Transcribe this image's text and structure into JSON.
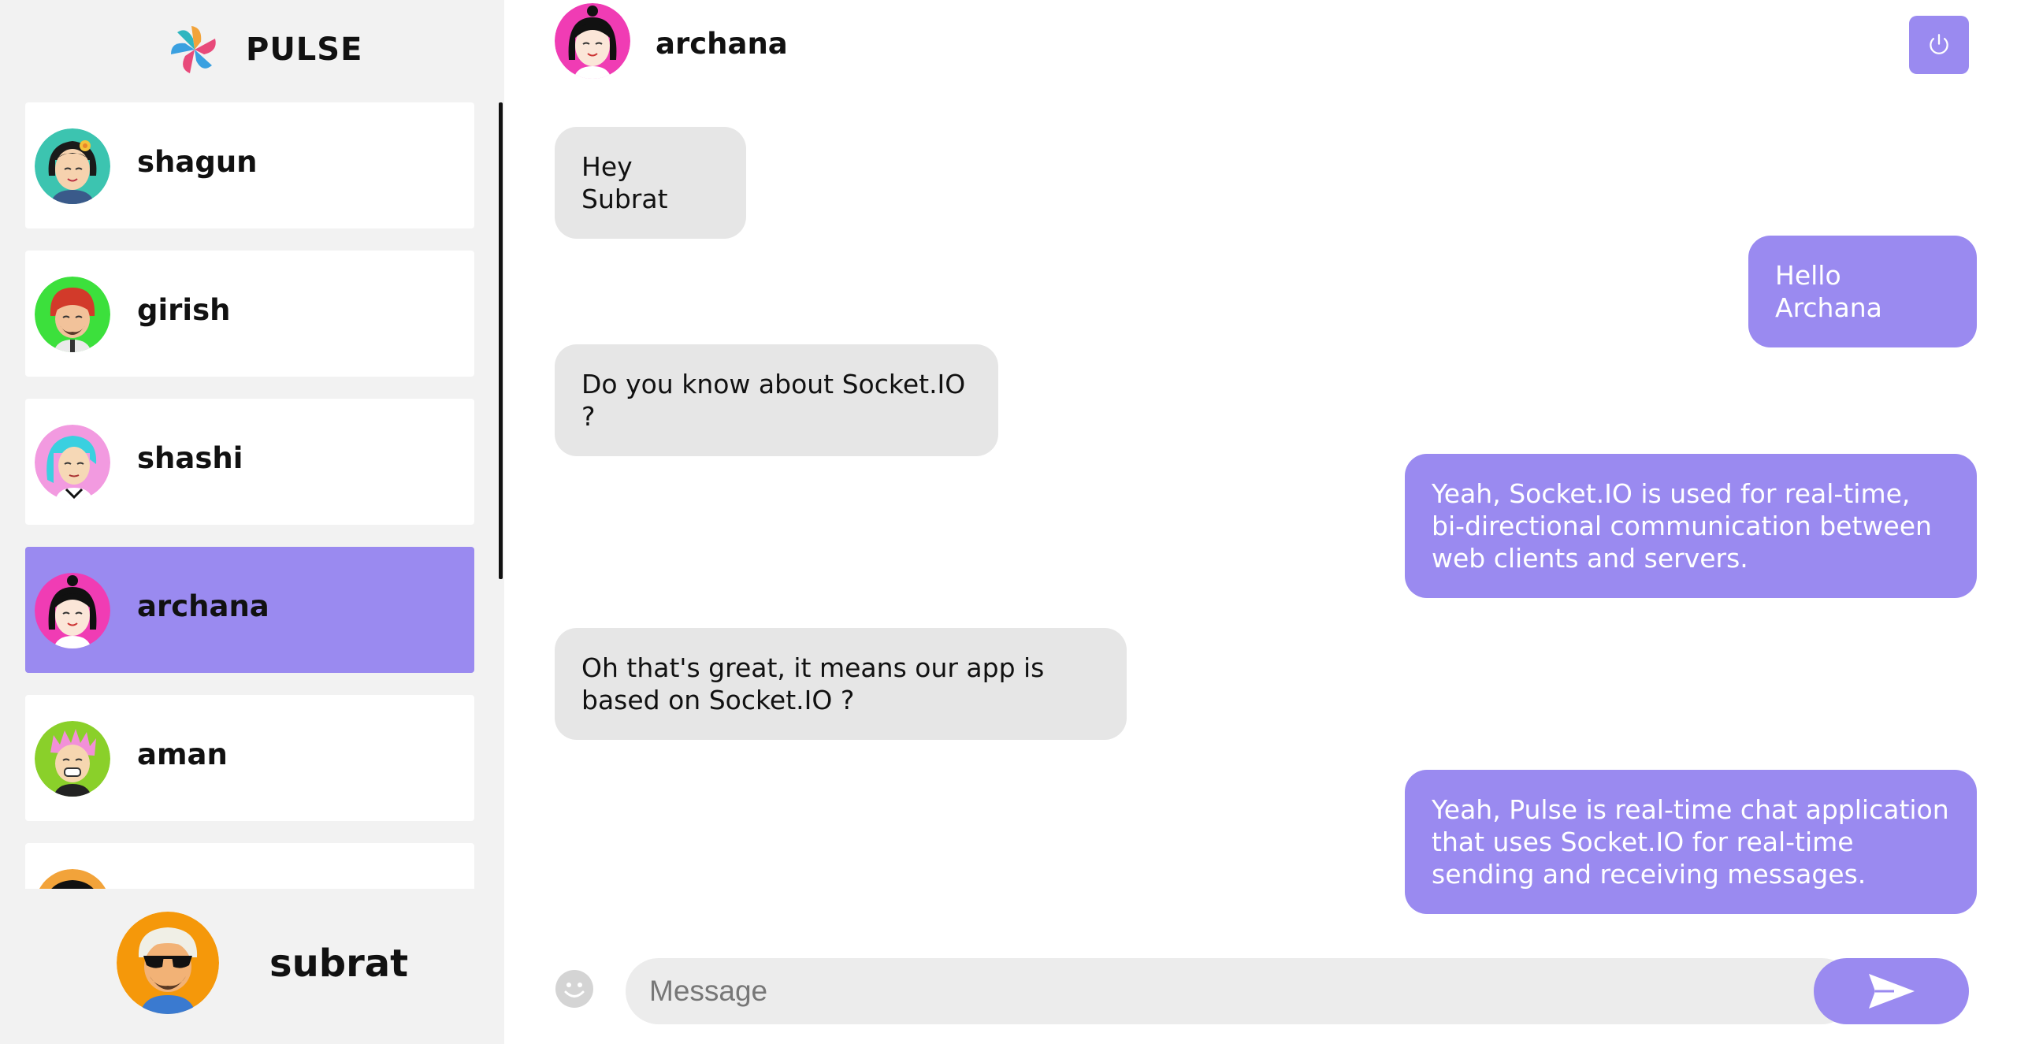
{
  "brand": {
    "name": "PULSE"
  },
  "contacts": [
    {
      "name": "shagun",
      "active": false
    },
    {
      "name": "girish",
      "active": false
    },
    {
      "name": "shashi",
      "active": false
    },
    {
      "name": "archana",
      "active": true
    },
    {
      "name": "aman",
      "active": false
    }
  ],
  "current_user": {
    "name": "subrat"
  },
  "chat": {
    "recipient": "archana",
    "messages": [
      {
        "direction": "in",
        "text": "Hey Subrat"
      },
      {
        "direction": "out",
        "text": "Hello Archana"
      },
      {
        "direction": "in",
        "text": "Do you know about Socket.IO ?"
      },
      {
        "direction": "out",
        "text": "Yeah, Socket.IO is used for real-time, bi-directional communication between web clients and servers."
      },
      {
        "direction": "in",
        "text": "Oh that's great, it means our app is based on Socket.IO ?"
      },
      {
        "direction": "out",
        "text": "Yeah, Pulse is real-time chat application that uses Socket.IO for real-time sending and receiving messages."
      }
    ],
    "input_placeholder": "Message"
  },
  "colors": {
    "accent": "#9a8af0",
    "incoming_bubble": "#e6e6e6",
    "sidebar_bg": "#f2f2f2"
  },
  "icons": {
    "brand": "pinwheel-logo-icon",
    "power": "power-icon",
    "emoji": "smiley-icon",
    "send": "send-icon"
  }
}
